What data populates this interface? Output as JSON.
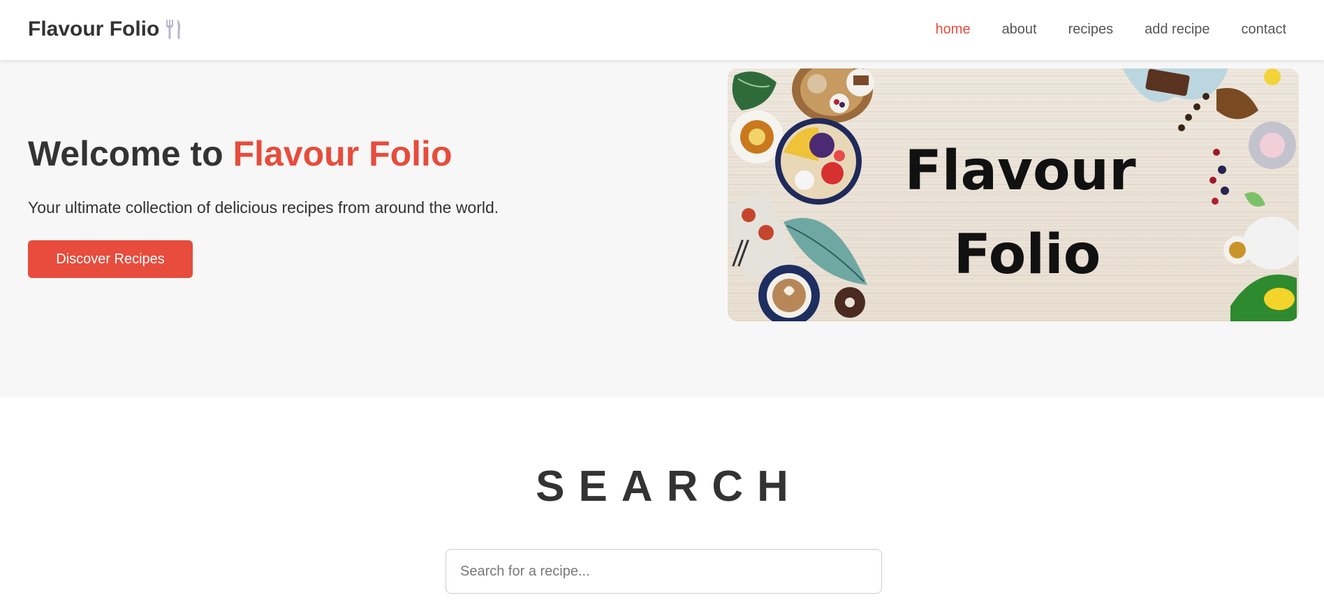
{
  "header": {
    "logo_text": "Flavour Folio",
    "logo_icon": "fork-knife-icon",
    "nav": [
      {
        "label": "home",
        "active": true
      },
      {
        "label": "about",
        "active": false
      },
      {
        "label": "recipes",
        "active": false
      },
      {
        "label": "add recipe",
        "active": false
      },
      {
        "label": "contact",
        "active": false
      }
    ]
  },
  "hero": {
    "title_prefix": "Welcome to ",
    "title_accent": "Flavour Folio",
    "subtitle": "Your ultimate collection of delicious recipes from around the world.",
    "cta_label": "Discover Recipes",
    "banner": {
      "line1": "Flavour",
      "line2": "Folio"
    }
  },
  "search": {
    "heading": "SEARCH",
    "placeholder": "Search for a recipe..."
  },
  "colors": {
    "accent": "#e74c3c",
    "text": "#333333",
    "hero_bg": "#f7f7f7"
  }
}
